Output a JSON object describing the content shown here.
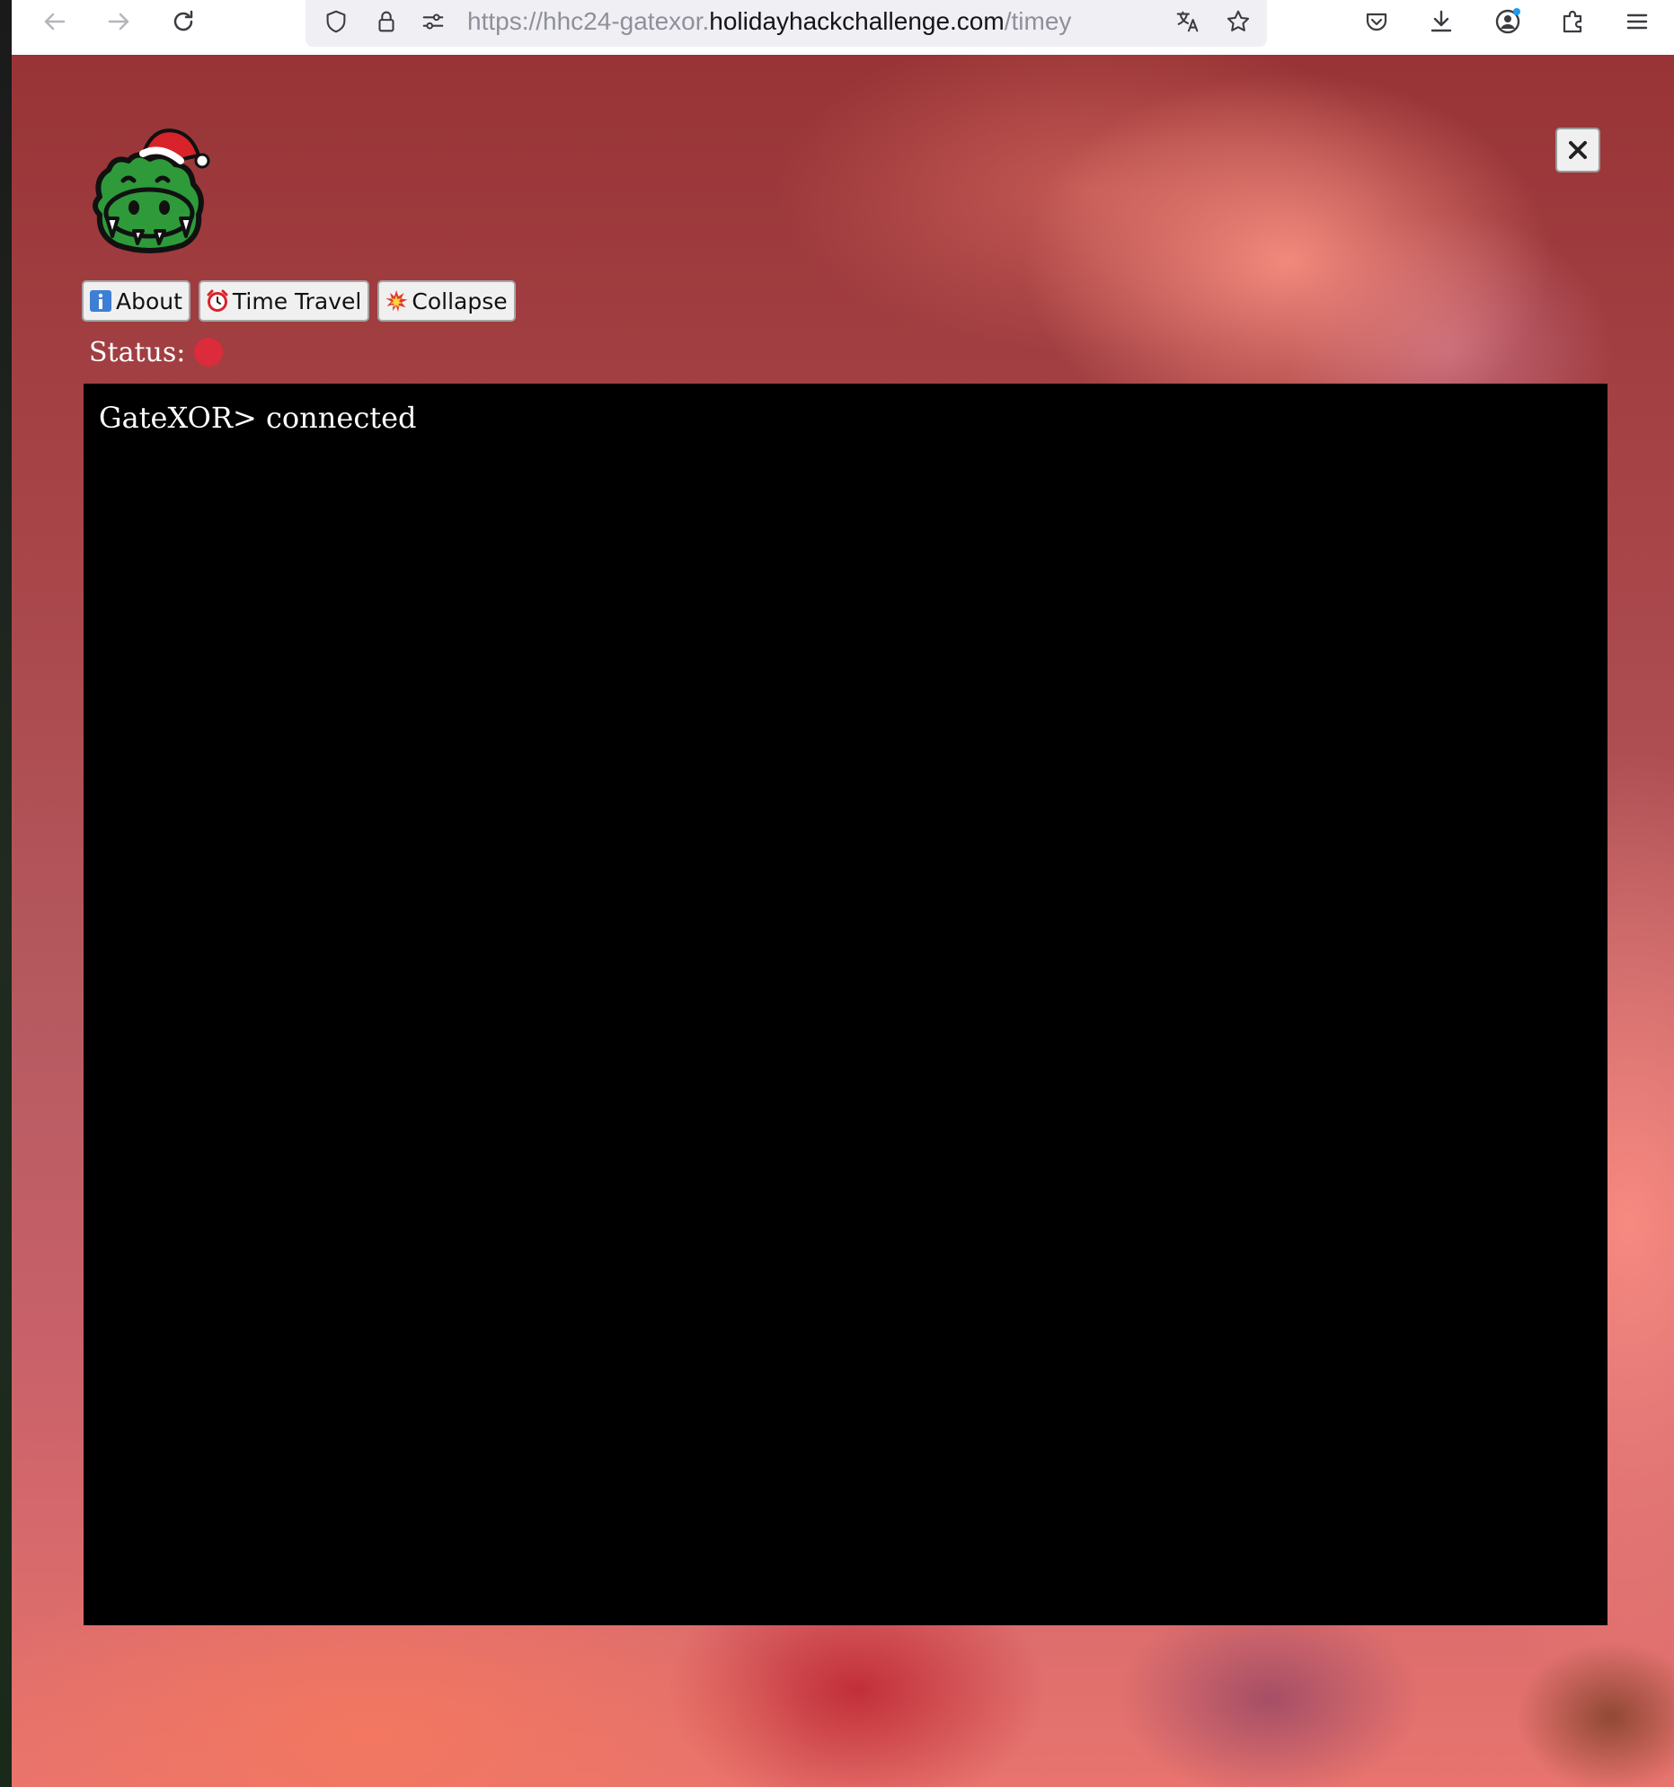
{
  "browser": {
    "url": {
      "prefix": "https://hhc24-gatexor.",
      "domain": "holidayhackchallenge.com",
      "path": "/timey"
    },
    "icons": {
      "back": "back-arrow-icon",
      "forward": "forward-arrow-icon",
      "reload": "reload-icon",
      "tracking_protection": "shield-icon",
      "secure": "lock-icon",
      "permissions": "permissions-icon",
      "translate": "translate-icon",
      "bookmark": "star-icon",
      "pocket": "pocket-icon",
      "downloads": "download-icon",
      "account": "account-icon",
      "extensions": "extensions-icon",
      "menu": "hamburger-menu-icon"
    }
  },
  "app": {
    "logo": "gator-santa-hat-logo",
    "close_label": "✕",
    "buttons": [
      {
        "label": "About",
        "icon": "info-icon"
      },
      {
        "label": "Time Travel",
        "icon": "alarm-clock-icon"
      },
      {
        "label": "Collapse",
        "icon": "collision-icon"
      }
    ],
    "status": {
      "label": "Status:",
      "color": "#dc2b3b"
    },
    "terminal": {
      "lines": [
        "GateXOR> connected"
      ]
    }
  },
  "colors": {
    "terminal_bg": "#000000",
    "terminal_text": "#ffffff",
    "status_dot": "#dc2b3b",
    "gator_green": "#2e9a3a"
  }
}
